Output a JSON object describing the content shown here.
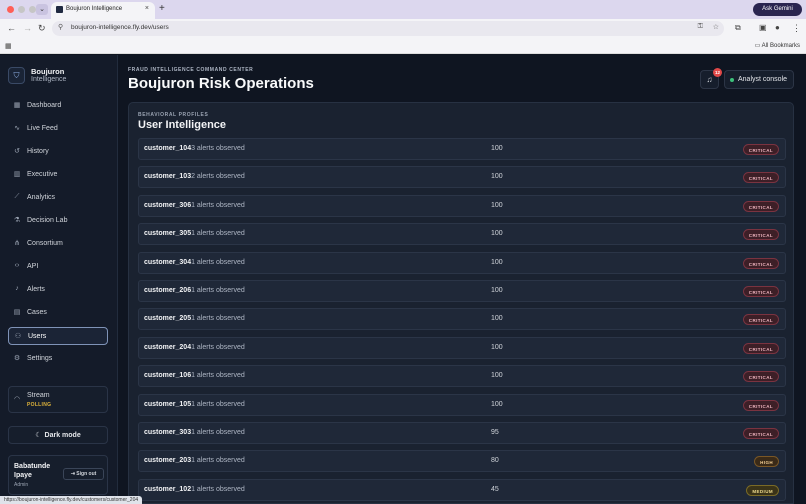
{
  "browser": {
    "tab_title": "Boujuron Intelligence",
    "ask_gemini": "Ask Gemini",
    "url": "boujuron-intelligence.fly.dev/users",
    "all_bookmarks": "All Bookmarks",
    "status_url": "https://boujuron-intelligence.fly.dev/customers/customer_204",
    "colors": {
      "close": "#ff5f57",
      "minimize": "#c6c6c6",
      "zoom": "#c6c6c6"
    }
  },
  "sidebar": {
    "brand_name": "Boujuron",
    "brand_sub": "Intelligence",
    "items": [
      {
        "label": "Dashboard",
        "icon": "grid-icon",
        "glyph": "▦"
      },
      {
        "label": "Live Feed",
        "icon": "activity-icon",
        "glyph": "∿"
      },
      {
        "label": "History",
        "icon": "history-icon",
        "glyph": "↺"
      },
      {
        "label": "Executive",
        "icon": "bar-chart-icon",
        "glyph": "▥"
      },
      {
        "label": "Analytics",
        "icon": "trend-icon",
        "glyph": "⟋"
      },
      {
        "label": "Decision Lab",
        "icon": "flask-icon",
        "glyph": "⚗"
      },
      {
        "label": "Consortium",
        "icon": "network-icon",
        "glyph": "⋔"
      },
      {
        "label": "API",
        "icon": "code-icon",
        "glyph": "‹›"
      },
      {
        "label": "Alerts",
        "icon": "bell-icon",
        "glyph": "♪"
      },
      {
        "label": "Cases",
        "icon": "briefcase-icon",
        "glyph": "▤"
      },
      {
        "label": "Users",
        "icon": "users-icon",
        "glyph": "⚇",
        "active": true
      },
      {
        "label": "Settings",
        "icon": "gear-icon",
        "glyph": "⚙"
      }
    ],
    "stream_label": "Stream",
    "stream_status": "POLLING",
    "dark_mode_label": "Dark mode",
    "user_name": "Babatunde Ipaye",
    "user_role": "Admin",
    "sign_out_label": "Sign out"
  },
  "header": {
    "eyebrow": "FRAUD INTELLIGENCE COMMAND CENTER",
    "title": "Boujuron Risk Operations",
    "notification_count": "12",
    "console_label": "Analyst console",
    "console_status_color": "#3cc07a"
  },
  "panel": {
    "eyebrow": "BEHAVIORAL PROFILES",
    "title": "User Intelligence",
    "rows": [
      {
        "id": "customer_104",
        "alerts": "3 alerts observed",
        "score": "100",
        "level": "CRITICAL",
        "tone": "critical"
      },
      {
        "id": "customer_103",
        "alerts": "2 alerts observed",
        "score": "100",
        "level": "CRITICAL",
        "tone": "critical"
      },
      {
        "id": "customer_306",
        "alerts": "1 alerts observed",
        "score": "100",
        "level": "CRITICAL",
        "tone": "critical"
      },
      {
        "id": "customer_305",
        "alerts": "1 alerts observed",
        "score": "100",
        "level": "CRITICAL",
        "tone": "critical"
      },
      {
        "id": "customer_304",
        "alerts": "1 alerts observed",
        "score": "100",
        "level": "CRITICAL",
        "tone": "critical"
      },
      {
        "id": "customer_206",
        "alerts": "1 alerts observed",
        "score": "100",
        "level": "CRITICAL",
        "tone": "critical"
      },
      {
        "id": "customer_205",
        "alerts": "1 alerts observed",
        "score": "100",
        "level": "CRITICAL",
        "tone": "critical"
      },
      {
        "id": "customer_204",
        "alerts": "1 alerts observed",
        "score": "100",
        "level": "CRITICAL",
        "tone": "critical"
      },
      {
        "id": "customer_106",
        "alerts": "1 alerts observed",
        "score": "100",
        "level": "CRITICAL",
        "tone": "critical"
      },
      {
        "id": "customer_105",
        "alerts": "1 alerts observed",
        "score": "100",
        "level": "CRITICAL",
        "tone": "critical"
      },
      {
        "id": "customer_303",
        "alerts": "1 alerts observed",
        "score": "95",
        "level": "CRITICAL",
        "tone": "critical"
      },
      {
        "id": "customer_203",
        "alerts": "1 alerts observed",
        "score": "80",
        "level": "HIGH",
        "tone": "high"
      },
      {
        "id": "customer_102",
        "alerts": "1 alerts observed",
        "score": "45",
        "level": "MEDIUM",
        "tone": "medium"
      }
    ]
  }
}
